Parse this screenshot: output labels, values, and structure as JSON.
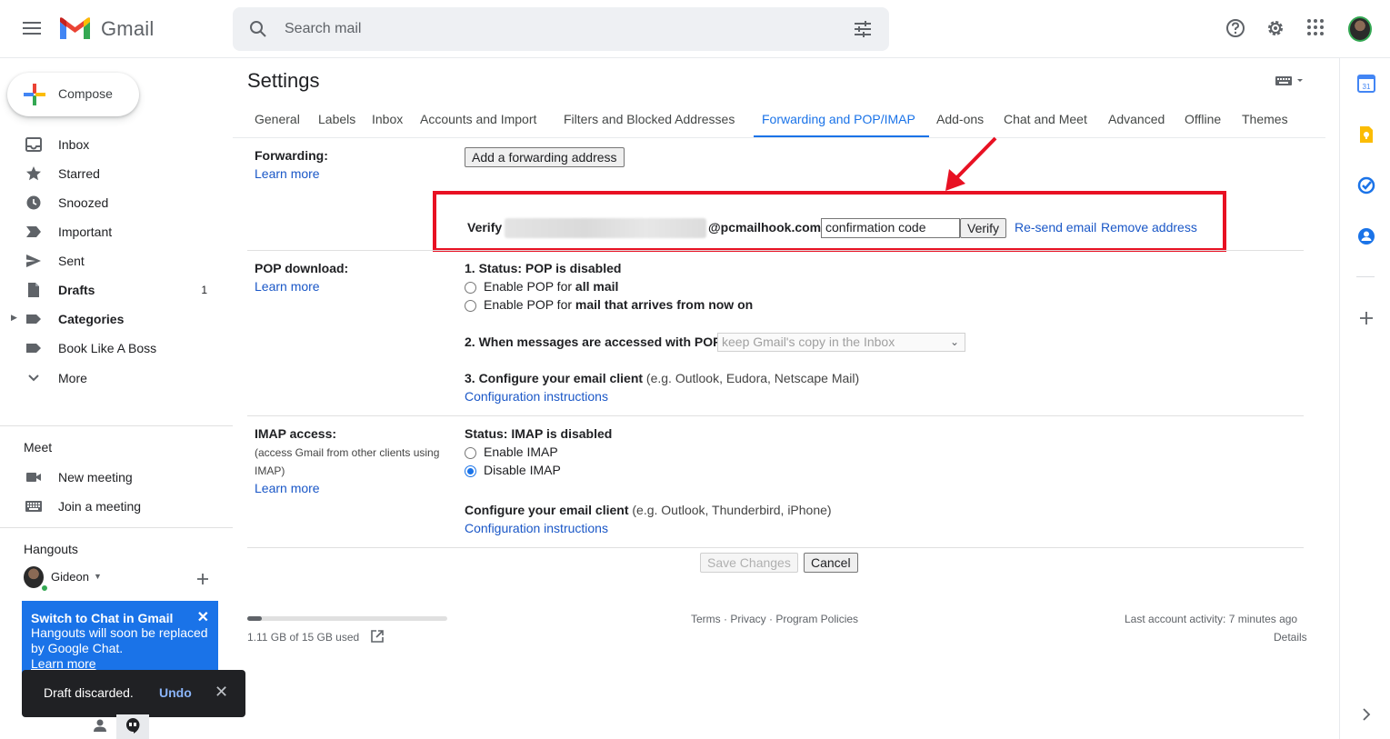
{
  "header": {
    "app_name": "Gmail",
    "search_placeholder": "Search mail"
  },
  "compose_label": "Compose",
  "sidebar": {
    "items": [
      {
        "label": "Inbox",
        "count": ""
      },
      {
        "label": "Starred",
        "count": ""
      },
      {
        "label": "Snoozed",
        "count": ""
      },
      {
        "label": "Important",
        "count": ""
      },
      {
        "label": "Sent",
        "count": ""
      },
      {
        "label": "Drafts",
        "count": "1"
      },
      {
        "label": "Categories",
        "count": ""
      },
      {
        "label": "Book Like A Boss",
        "count": ""
      },
      {
        "label": "More",
        "count": ""
      }
    ],
    "meet": {
      "title": "Meet",
      "new_meeting": "New meeting",
      "join_meeting": "Join a meeting"
    },
    "hangouts": {
      "title": "Hangouts",
      "user": "Gideon"
    }
  },
  "promo": {
    "title": "Switch to Chat in Gmail",
    "body": "Hangouts will soon be replaced by Google Chat.",
    "link": "Learn more",
    "close": "✕"
  },
  "toast": {
    "message": "Draft discarded.",
    "undo": "Undo",
    "close": "✕"
  },
  "settings": {
    "title": "Settings",
    "tabs": [
      "General",
      "Labels",
      "Inbox",
      "Accounts and Import",
      "Filters and Blocked Addresses",
      "Forwarding and POP/IMAP",
      "Add-ons",
      "Chat and Meet",
      "Advanced",
      "Offline",
      "Themes"
    ],
    "active_tab": "Forwarding and POP/IMAP",
    "forwarding": {
      "label": "Forwarding:",
      "learn_more": "Learn more",
      "add_button": "Add a forwarding address",
      "verify_label": "Verify",
      "email_domain": "@pcmailhook.com",
      "code_placeholder": "confirmation code",
      "verify_button": "Verify",
      "resend": "Re-send email",
      "remove": "Remove address"
    },
    "pop": {
      "label": "POP download:",
      "learn_more": "Learn more",
      "status": "1. Status: POP is disabled",
      "opt1_prefix": "Enable POP for ",
      "opt1_bold": "all mail",
      "opt2_prefix": "Enable POP for ",
      "opt2_bold": "mail that arrives from now on",
      "step2": "2. When messages are accessed with POP",
      "step2_select": "keep Gmail's copy in the Inbox",
      "step3_bold": "3. Configure your email client",
      "step3_rest": " (e.g. Outlook, Eudora, Netscape Mail)",
      "config_link": "Configuration instructions"
    },
    "imap": {
      "label": "IMAP access:",
      "desc": "(access Gmail from other clients using IMAP)",
      "learn_more": "Learn more",
      "status": "Status: IMAP is disabled",
      "enable": "Enable IMAP",
      "disable": "Disable IMAP",
      "selected": "Disable IMAP",
      "config_bold": "Configure your email client",
      "config_rest": " (e.g. Outlook, Thunderbird, iPhone)",
      "config_link": "Configuration instructions"
    },
    "save_button": "Save Changes",
    "cancel_button": "Cancel"
  },
  "footer": {
    "storage": "1.11 GB of 15 GB used",
    "storage_fraction": 0.074,
    "links": "Terms · Privacy · Program Policies",
    "activity": "Last account activity: 7 minutes ago",
    "details": "Details"
  },
  "colors": {
    "accent": "#1a73e8",
    "highlight_box": "#e81123"
  }
}
